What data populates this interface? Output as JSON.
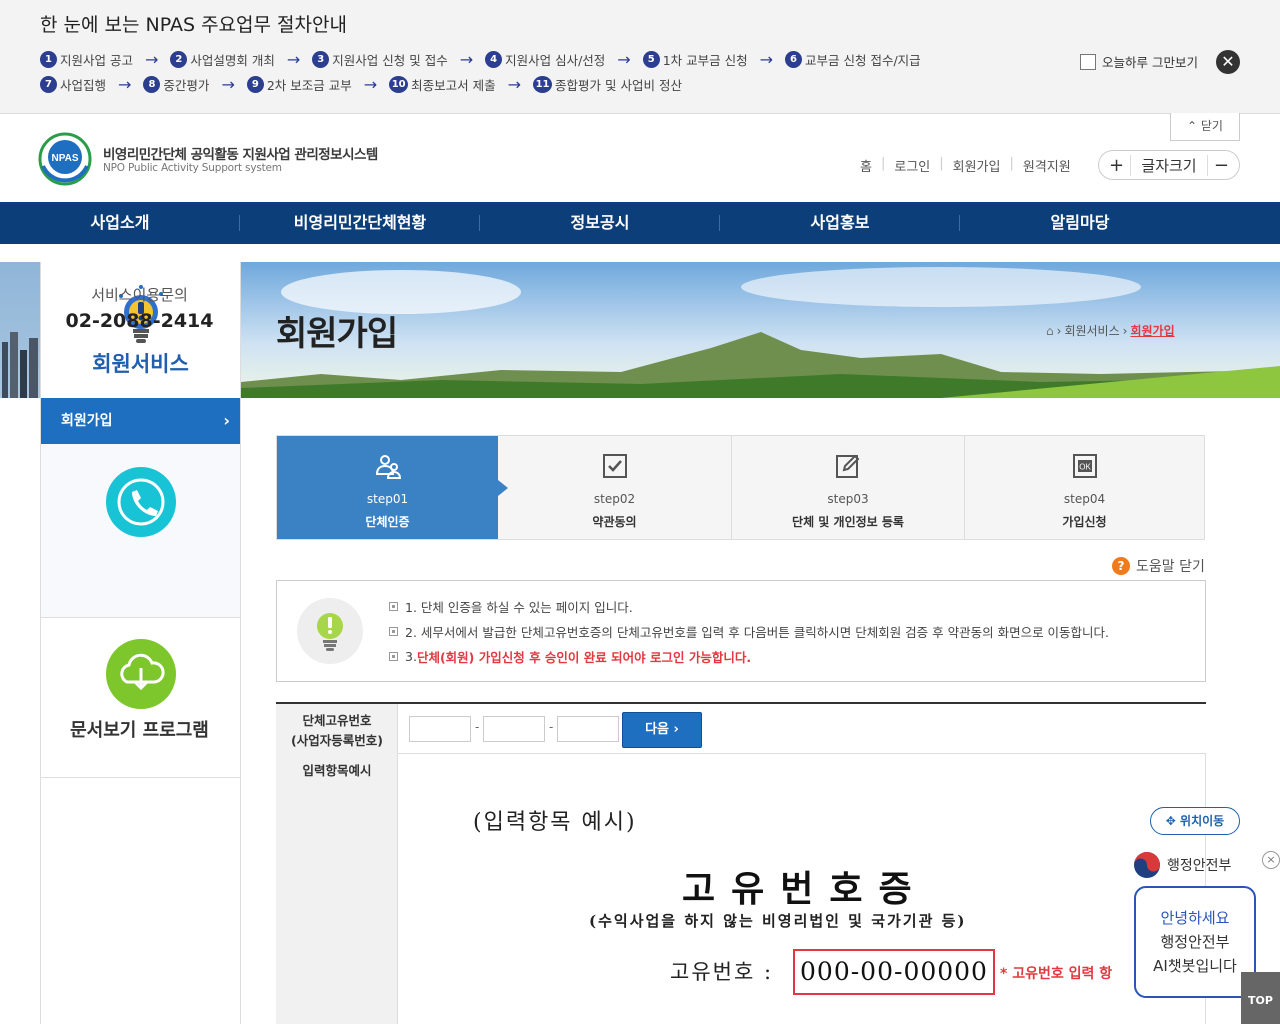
{
  "guide": {
    "title": "한 눈에 보는 NPAS 주요업무 절차안내",
    "row1": [
      {
        "num": "1",
        "label": "지원사업 공고"
      },
      {
        "num": "2",
        "label": "사업설명회 개최"
      },
      {
        "num": "3",
        "label": "지원사업 신청 및 접수"
      },
      {
        "num": "4",
        "label": "지원사업 심사/선정"
      },
      {
        "num": "5",
        "label": "1차 교부금 신청"
      },
      {
        "num": "6",
        "label": "교부금 신청 접수/지급"
      }
    ],
    "row2": [
      {
        "num": "7",
        "label": "사업집행"
      },
      {
        "num": "8",
        "label": "중간평가"
      },
      {
        "num": "9",
        "label": "2차 보조금 교부"
      },
      {
        "num": "10",
        "label": "최종보고서 제출"
      },
      {
        "num": "11",
        "label": "종합평가 및 사업비 정산"
      }
    ],
    "today_label": "오늘하루 그만보기",
    "collapse_label": "닫기"
  },
  "header": {
    "logo_mark": "NPAS",
    "logo_ko": "비영리민간단체 공익활동 지원사업 관리정보시스템",
    "logo_en": "NPO Public Activity Support system",
    "util": [
      "홈",
      "로그인",
      "회원가입",
      "원격지원"
    ],
    "font_size_label": "글자크기",
    "font_plus": "+",
    "font_minus": "−"
  },
  "gnb": [
    "사업소개",
    "비영리민간단체현황",
    "정보공시",
    "사업홍보",
    "알림마당"
  ],
  "sidebar": {
    "title": "회원서비스",
    "active_item": "회원가입",
    "contact_label": "서비스이용문의",
    "contact_phone": "02-2088-2414",
    "doc_label": "문서보기 프로그램"
  },
  "banner": {
    "heading": "회원가입",
    "crumbs": [
      "회원서비스",
      "회원가입"
    ]
  },
  "stepper": [
    {
      "step": "step01",
      "label": "단체인증",
      "active": true
    },
    {
      "step": "step02",
      "label": "약관동의",
      "active": false
    },
    {
      "step": "step03",
      "label": "단체 및 개인정보 등록",
      "active": false
    },
    {
      "step": "step04",
      "label": "가입신청",
      "active": false
    }
  ],
  "help": {
    "close_label": "도움말 닫기",
    "q": "?"
  },
  "notice": {
    "line1": "1. 단체 인증을 하실 수 있는 페이지 입니다.",
    "line2": "2. 세무서에서 발급한 단체고유번호증의 단체고유번호를 입력 후 다음버튼 클릭하시면 단체회원 검증 후 약관동의 화면으로 이동합니다.",
    "line3_prefix": "3. ",
    "line3_red": "단체(회원) 가입신청 후 승인이 완료 되어야 로그인 가능합니다."
  },
  "form": {
    "label1_a": "단체고유번호",
    "label1_b": "(사업자등록번호)",
    "label2": "입력항목예시",
    "dash": "-",
    "next_label": "다음",
    "example": {
      "title": "(입력항목 예시)",
      "cert": "고유번호증",
      "sub": "(수익사업을 하지 않는 비영리법인 및 국가기관 등)",
      "num_label": "고유번호 :",
      "num_value": "000-00-00000",
      "note": "* 고유번호 입력 항"
    }
  },
  "floating": {
    "move_label": "위치이동",
    "mois_label": "행정안전부",
    "chat_close": "×",
    "chat_l1": "안녕하세요",
    "chat_l2": "행정안전부",
    "chat_l3": "AI챗봇입니다",
    "top_label": "TOP"
  },
  "colors": {
    "brand_blue": "#0c3f7a",
    "step_active": "#3b82c4",
    "alert_red": "#e2383f"
  }
}
